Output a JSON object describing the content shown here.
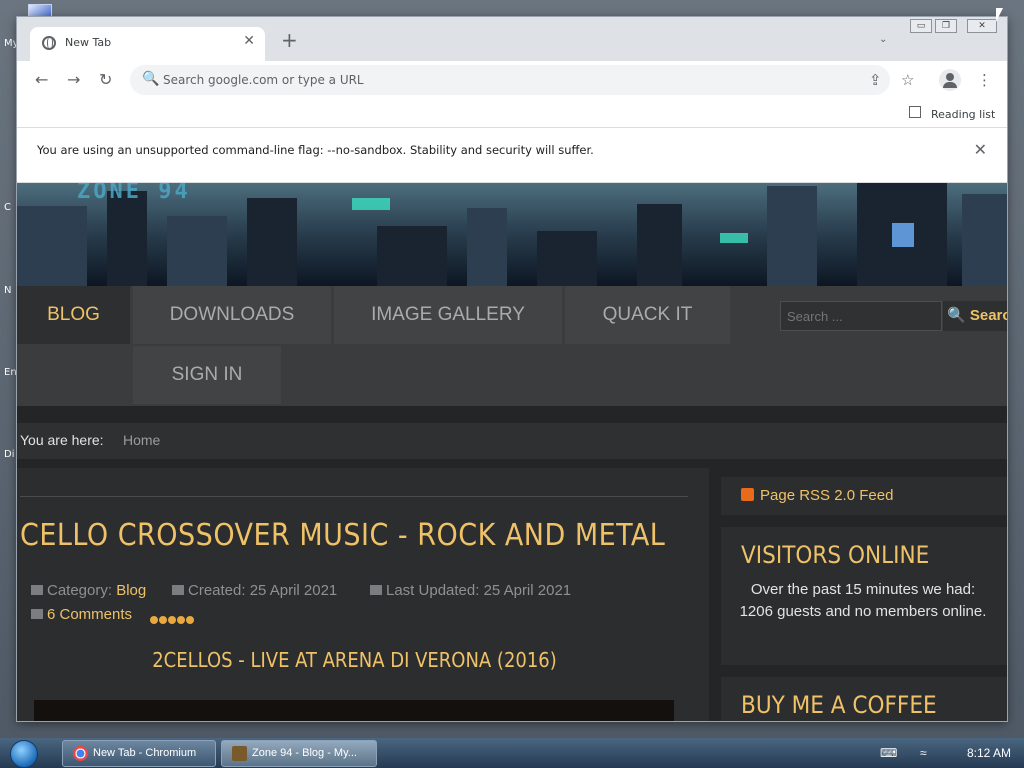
{
  "desktop": {
    "icon_labels": [
      "My",
      "C",
      "N",
      "En",
      "Di"
    ]
  },
  "browser": {
    "tab_title": "New Tab",
    "tab_close": "✕",
    "new_tab": "+",
    "tab_search": "⌄",
    "window_buttons": [
      "▭",
      "❐",
      "✕"
    ],
    "back": "←",
    "forward": "→",
    "reload": "↻",
    "omnibox_placeholder": "Search google.com or type a URL",
    "share_icon": "⇪",
    "star_icon": "☆",
    "menu_icon": "⋮",
    "reading_list": "Reading list",
    "infobar_text": "You are using an unsupported command-line flag: --no-sandbox. Stability and security will suffer.",
    "infobar_close": "✕"
  },
  "site": {
    "logo": "ZONE 94",
    "nav": [
      "BLOG",
      "DOWNLOADS",
      "IMAGE GALLERY",
      "QUACK IT",
      "SIGN IN"
    ],
    "search_placeholder": "Search ...",
    "search_button": "Search",
    "breadcrumb_label": "You are here:",
    "breadcrumb_home": "Home",
    "article": {
      "title": "CELLO CROSSOVER MUSIC - ROCK AND METAL",
      "category_label": "Category:",
      "category": "Blog",
      "created": "Created: 25 April 2021",
      "updated": "Last Updated: 25 April 2021",
      "comments": "6 Comments",
      "rating_stars": 5,
      "video_title": "2CELLOS - LIVE AT ARENA DI VERONA (2016)"
    },
    "sidebar": {
      "rss": "Page RSS 2.0 Feed",
      "visitors_title": "VISITORS ONLINE",
      "visitors_text": "Over the past 15 minutes we had: 1206 guests and no members online.",
      "coffee_title": "BUY ME A COFFEE"
    }
  },
  "taskbar": {
    "items": [
      "New Tab - Chromium",
      "Zone 94 - Blog - My..."
    ],
    "clock": "8:12 AM"
  }
}
